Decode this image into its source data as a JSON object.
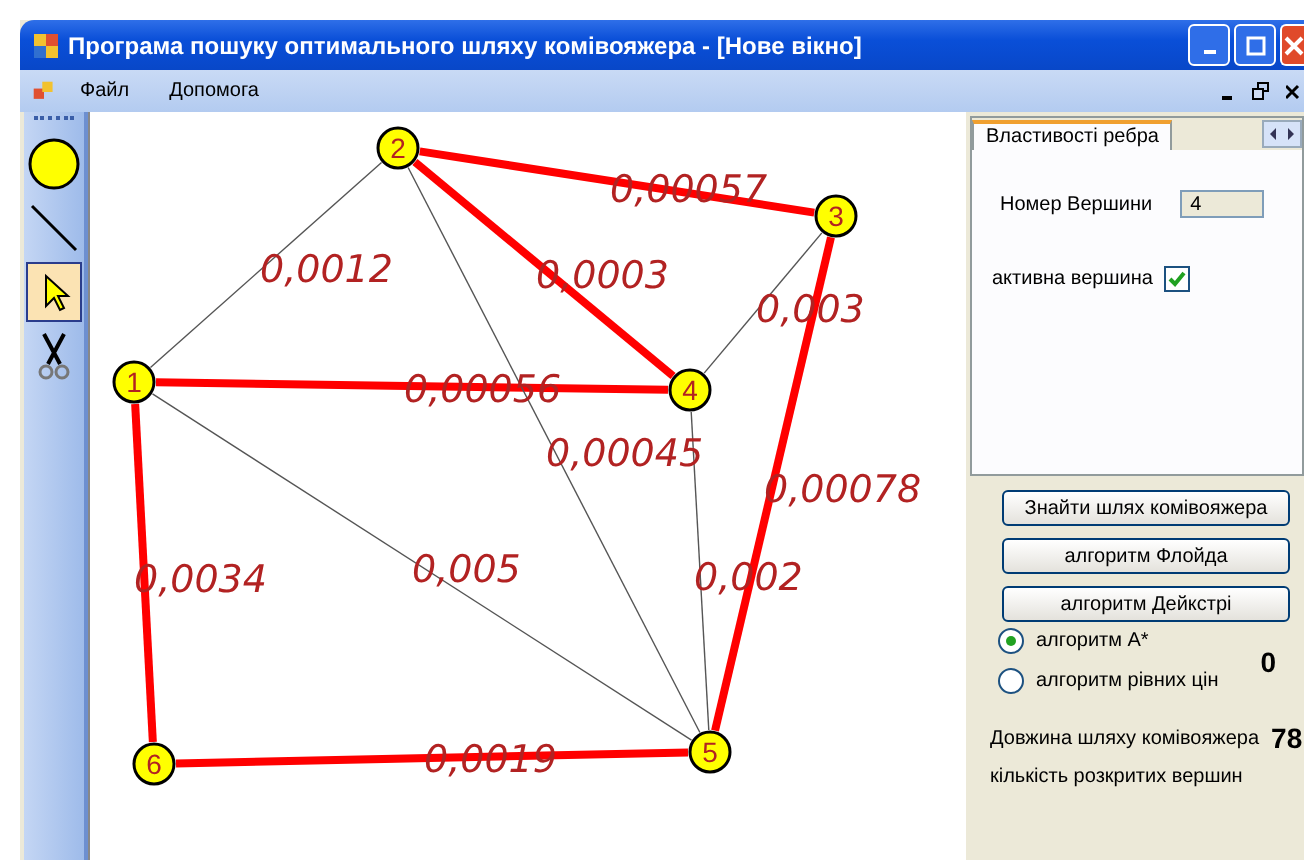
{
  "window": {
    "title": "Програма пошуку оптимального шляху комівояжера - [Нове вікно]"
  },
  "menu": [
    "Файл",
    "Допомога"
  ],
  "tools": [
    {
      "kind": "node",
      "selected": false
    },
    {
      "kind": "edge",
      "selected": false
    },
    {
      "kind": "pointer",
      "selected": true
    },
    {
      "kind": "cut",
      "selected": false
    }
  ],
  "graph": {
    "nodes": [
      {
        "label": "1"
      },
      {
        "label": "2"
      },
      {
        "label": "3"
      },
      {
        "label": "4"
      },
      {
        "label": "5"
      },
      {
        "label": "6"
      }
    ],
    "edges": [
      {
        "weight": "0,00057",
        "on_path": true
      },
      {
        "weight": "0,0012",
        "on_path": false
      },
      {
        "weight": "0,0003",
        "on_path": true
      },
      {
        "weight": "0,003",
        "on_path": false
      },
      {
        "weight": "0,00056",
        "on_path": true
      },
      {
        "weight": "0,00045",
        "on_path": false
      },
      {
        "weight": "0,00078",
        "on_path": true
      },
      {
        "weight": "0,0034",
        "on_path": true
      },
      {
        "weight": "0,005",
        "on_path": false
      },
      {
        "weight": "0,002",
        "on_path": false
      },
      {
        "weight": "0,0019",
        "on_path": true
      }
    ]
  },
  "properties": {
    "tab": "Властивості ребра",
    "vertex_label": "Номер Вершини",
    "vertex_value": "4",
    "active_label": "активна вершина",
    "active": true
  },
  "buttons": [
    "Знайти шлях комівояжера",
    "алгоритм Флойда",
    "алгоритм Дейкстрі"
  ],
  "algorithms": [
    {
      "label": "алгоритм A*",
      "selected": true
    },
    {
      "label": "алгоритм рівних цін",
      "selected": false
    }
  ],
  "expanded_count": "0",
  "length_label": "Довжина шляху комівояжера",
  "length_value": "78",
  "expanded_label": "кількість розкритих вершин"
}
